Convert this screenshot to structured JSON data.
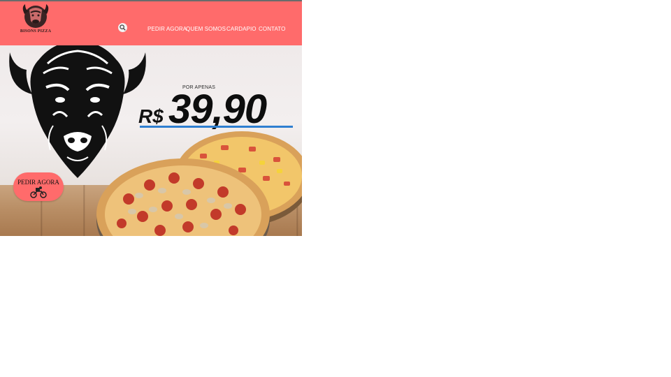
{
  "brand": {
    "name": "BISONS PIZZA"
  },
  "header": {
    "search_icon": "search-icon",
    "nav": [
      {
        "label": "PEDIR AGORA"
      },
      {
        "label": "QUEM SOMOS"
      },
      {
        "label": "CARDAPIO"
      },
      {
        "label": "CONTATO"
      }
    ]
  },
  "hero": {
    "price_prefix": "POR APENAS",
    "currency": "R$",
    "price": "39,90",
    "cta_label": "PEDIR AGORA",
    "cta_icon": "motorcycle-delivery-icon"
  },
  "colors": {
    "header": "#ff6b6b",
    "accent_underline": "#2f7fd0",
    "text_dark": "#111111"
  }
}
